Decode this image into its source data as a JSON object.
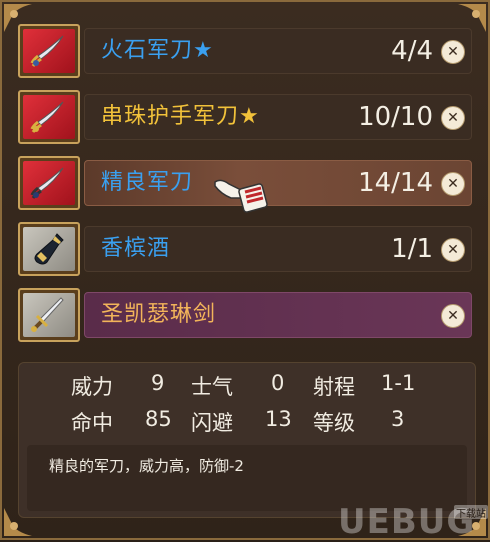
{
  "items": [
    {
      "name": "火石军刀★",
      "count": "4/4",
      "icon": "saber-icon",
      "name_color": "blue"
    },
    {
      "name": "串珠护手军刀★",
      "count": "10/10",
      "icon": "saber-icon",
      "name_color": "gold"
    },
    {
      "name": "精良军刀",
      "count": "14/14",
      "icon": "saber-icon",
      "name_color": "blue"
    },
    {
      "name": "香槟酒",
      "count": "1/1",
      "icon": "bottle-icon",
      "name_color": "blue"
    },
    {
      "name": "圣凯瑟琳剑",
      "count": "",
      "icon": "sword-icon",
      "name_color": "orange"
    }
  ],
  "close_symbol": "✕",
  "stats": {
    "power_label": "威力",
    "power_value": "9",
    "morale_label": "士气",
    "morale_value": "0",
    "range_label": "射程",
    "range_value": "1-1",
    "hit_label": "命中",
    "hit_value": "85",
    "dodge_label": "闪避",
    "dodge_value": "13",
    "level_label": "等级",
    "level_value": "3"
  },
  "description": "精良的军刀，威力高，防御-2",
  "watermark": {
    "text": "UEBUG",
    "tag": "下载站"
  },
  "colors": {
    "blue": "#3aa0f0",
    "gold": "#f2c23a",
    "orange": "#f2b45a"
  }
}
